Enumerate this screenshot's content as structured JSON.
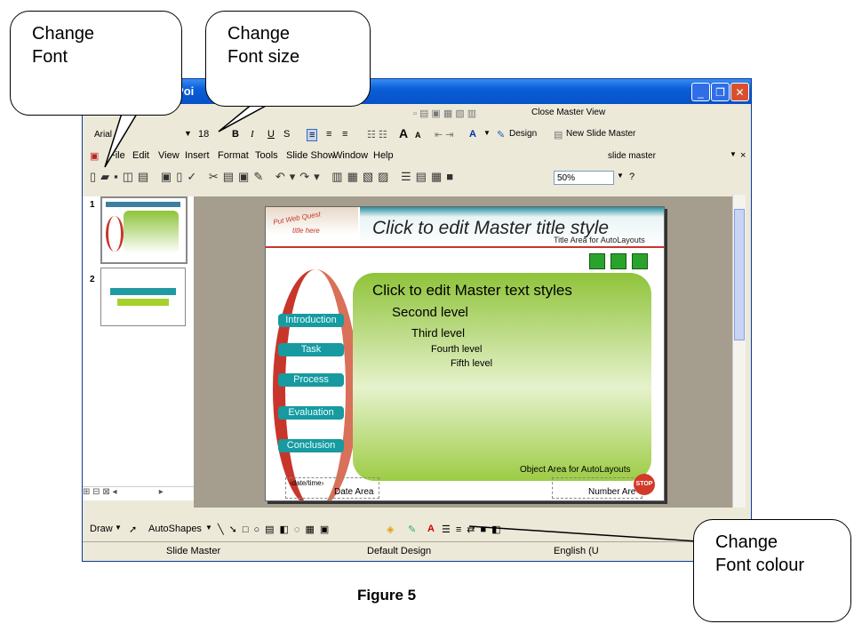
{
  "callouts": {
    "font": "Change\nFont",
    "font_size": "Change\nFont size",
    "font_colour": "Change\nFont colour"
  },
  "window": {
    "title_fragment": "rPoi"
  },
  "formatting": {
    "font_name": "Arial",
    "font_size": "18",
    "bold": "B",
    "italic": "I",
    "underline": "U",
    "shadow": "S",
    "grow_font": "A",
    "shrink_font": "A",
    "design": "Design",
    "new_slide_master": "New Slide Master"
  },
  "master_toolbar": {
    "close_master_view": "Close Master View"
  },
  "menu": {
    "items": [
      "File",
      "Edit",
      "View",
      "Insert",
      "Format",
      "Tools",
      "Slide Show",
      "Window",
      "Help"
    ],
    "help_search": "slide master"
  },
  "standard": {
    "zoom": "50%"
  },
  "slide": {
    "logo_line1": "Put Web Quest",
    "logo_line2": "title here",
    "title": "Click to edit Master title style",
    "title_area_label": "Title Area for AutoLayouts",
    "body_levels": [
      "Click to edit Master text styles",
      "Second level",
      "Third level",
      "Fourth level",
      "Fifth level"
    ],
    "buttons": [
      "Introduction",
      "Task",
      "Process",
      "Evaluation",
      "Conclusion"
    ],
    "object_area_label": "Object Area for AutoLayouts",
    "date_placeholder": "‹date/time›",
    "date_area": "Date Area",
    "number_area": "Number Are",
    "stop": "STOP"
  },
  "thumbnails": [
    {
      "number": "1"
    },
    {
      "number": "2"
    }
  ],
  "drawing": {
    "draw": "Draw",
    "autoshapes": "AutoShapes"
  },
  "status": {
    "left": "Slide Master",
    "middle": "Default Design",
    "right": "English (U"
  },
  "caption": "Figure 5",
  "colors": {
    "title_blue": "#0a5ed8",
    "slide_green": "#7ab51d",
    "menu_teal": "#179aa0",
    "arc_red": "#c8362b"
  }
}
